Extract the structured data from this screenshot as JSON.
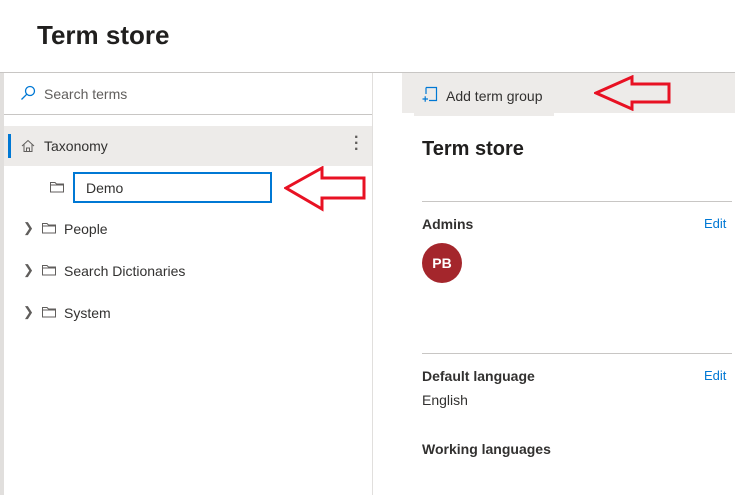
{
  "header": {
    "title": "Term store"
  },
  "search": {
    "placeholder": "Search terms"
  },
  "tree": {
    "root": "Taxonomy",
    "new_group_value": "Demo",
    "items": [
      {
        "label": "People"
      },
      {
        "label": "Search Dictionaries"
      },
      {
        "label": "System"
      }
    ]
  },
  "toolbar": {
    "add_term_group": "Add term group"
  },
  "details": {
    "title": "Term store",
    "admins_label": "Admins",
    "edit_label": "Edit",
    "admin_initials": "PB",
    "default_language_label": "Default language",
    "default_language": "English",
    "working_languages_label": "Working languages"
  },
  "colors": {
    "accent": "#0078d4",
    "avatar": "#a4262c",
    "annotation": "#e81123"
  }
}
